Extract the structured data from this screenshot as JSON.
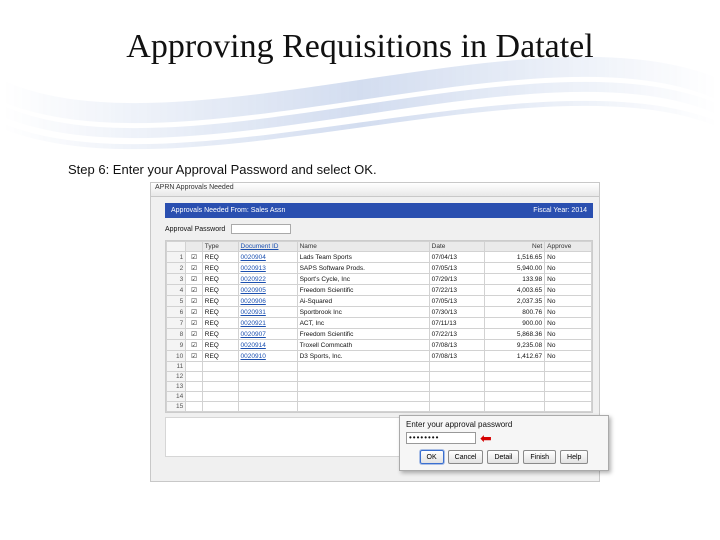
{
  "slide": {
    "title": "Approving Requisitions in Datatel",
    "step": "Step 6: Enter your Approval Password and select OK."
  },
  "window": {
    "title": "APRN Approvals Needed",
    "bluebar_left": "Approvals Needed From: Sales Assn",
    "bluebar_right": "Fiscal Year: 2014",
    "password_label": "Approval Password"
  },
  "grid": {
    "headers": {
      "type": "Type",
      "docid": "Document ID",
      "name": "Name",
      "date": "Date",
      "net": "Net",
      "approve": "Approve"
    },
    "rows": [
      {
        "n": "1",
        "type": "REQ",
        "docid": "0020904",
        "name": "Lads Team Sports",
        "date": "07/04/13",
        "net": "1,516.65",
        "approve": "No"
      },
      {
        "n": "2",
        "type": "REQ",
        "docid": "0020913",
        "name": "SAPS Software Prods.",
        "date": "07/05/13",
        "net": "5,940.00",
        "approve": "No"
      },
      {
        "n": "3",
        "type": "REQ",
        "docid": "0020922",
        "name": "Sport's Cycle, Inc",
        "date": "07/29/13",
        "net": "133.98",
        "approve": "No"
      },
      {
        "n": "4",
        "type": "REQ",
        "docid": "0020905",
        "name": "Freedom Scientific",
        "date": "07/22/13",
        "net": "4,003.65",
        "approve": "No"
      },
      {
        "n": "5",
        "type": "REQ",
        "docid": "0020906",
        "name": "Ai-Squared",
        "date": "07/05/13",
        "net": "2,037.35",
        "approve": "No"
      },
      {
        "n": "6",
        "type": "REQ",
        "docid": "0020931",
        "name": "Sportbrook Inc",
        "date": "07/30/13",
        "net": "800.76",
        "approve": "No"
      },
      {
        "n": "7",
        "type": "REQ",
        "docid": "0020921",
        "name": "ACT, Inc",
        "date": "07/11/13",
        "net": "900.00",
        "approve": "No"
      },
      {
        "n": "8",
        "type": "REQ",
        "docid": "0020907",
        "name": "Freedom Scientific",
        "date": "07/22/13",
        "net": "5,868.36",
        "approve": "No"
      },
      {
        "n": "9",
        "type": "REQ",
        "docid": "0020914",
        "name": "Troxell Commcath",
        "date": "07/08/13",
        "net": "9,235.08",
        "approve": "No"
      },
      {
        "n": "10",
        "type": "REQ",
        "docid": "0020910",
        "name": "D3 Sports, Inc.",
        "date": "07/08/13",
        "net": "1,412.67",
        "approve": "No"
      },
      {
        "n": "11",
        "type": "",
        "docid": "",
        "name": "",
        "date": "",
        "net": "",
        "approve": ""
      },
      {
        "n": "12",
        "type": "",
        "docid": "",
        "name": "",
        "date": "",
        "net": "",
        "approve": ""
      },
      {
        "n": "13",
        "type": "",
        "docid": "",
        "name": "",
        "date": "",
        "net": "",
        "approve": ""
      },
      {
        "n": "14",
        "type": "",
        "docid": "",
        "name": "",
        "date": "",
        "net": "",
        "approve": ""
      },
      {
        "n": "15",
        "type": "",
        "docid": "",
        "name": "",
        "date": "",
        "net": "",
        "approve": ""
      }
    ]
  },
  "prompt": {
    "label": "Enter your approval password",
    "masked": "••••••••",
    "buttons": {
      "ok": "OK",
      "cancel": "Cancel",
      "detail": "Detail",
      "finish": "Finish",
      "help": "Help"
    }
  }
}
